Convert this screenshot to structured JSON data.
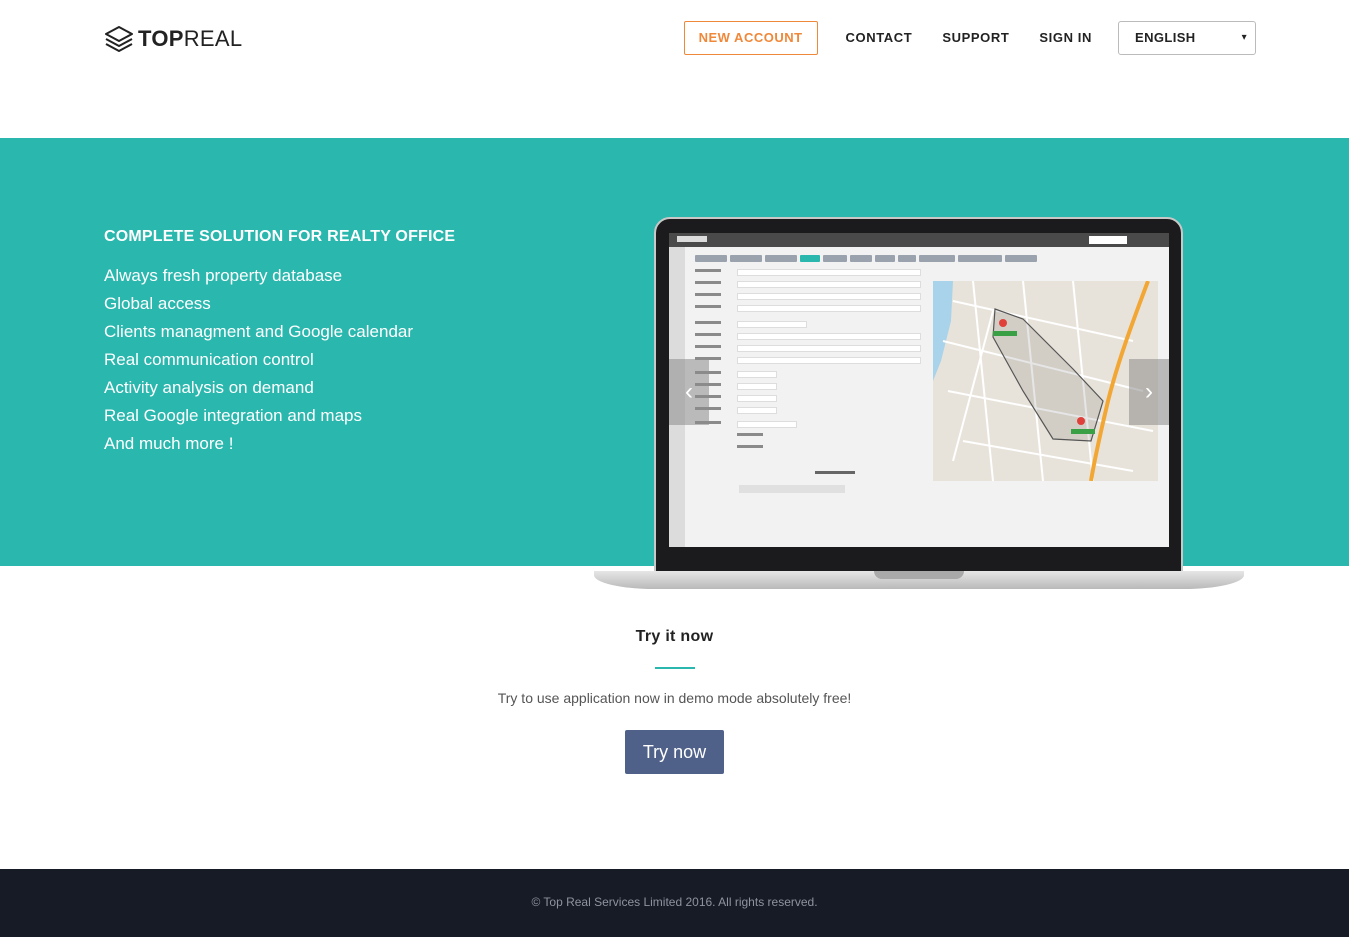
{
  "header": {
    "logo_bold": "TOP",
    "logo_light": "REAL",
    "nav": {
      "new_account": "NEW ACCOUNT",
      "contact": "CONTACT",
      "support": "SUPPORT",
      "sign_in": "SIGN IN"
    },
    "language": {
      "selected": "ENGLISH",
      "caret": "▾"
    }
  },
  "hero": {
    "title": "COMPLETE SOLUTION FOR REALTY OFFICE",
    "features": [
      "Always fresh property database",
      "Global access",
      "Clients managment and Google calendar",
      "Real communication control",
      "Activity analysis on demand",
      "Real Google integration and maps",
      "And much more !"
    ],
    "carousel": {
      "prev_glyph": "‹",
      "next_glyph": "›"
    }
  },
  "try_section": {
    "title": "Try it now",
    "description": "Try to use application now in demo mode absolutely free!",
    "button_label": "Try now"
  },
  "footer": {
    "copyright": "© Top Real Services Limited 2016. All rights reserved."
  },
  "colors": {
    "accent": "#2ab7ae",
    "new_account": "#f0883a",
    "try_button": "#4f6089",
    "footer_bg": "#171b26"
  }
}
